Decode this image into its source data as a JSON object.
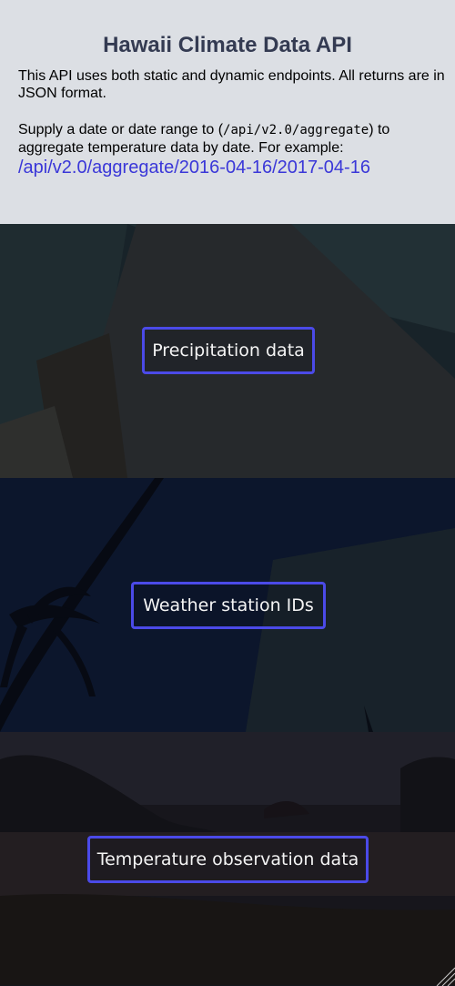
{
  "header": {
    "title": "Hawaii Climate Data API",
    "intro": "This API uses both static and dynamic endpoints. All returns are in JSON format.",
    "aggregate_prefix": "Supply a date or date range to (",
    "aggregate_code": "/api/v2.0/aggregate",
    "aggregate_suffix": ") to aggregate temperature data by date. For example:",
    "example_link": "/api/v2.0/aggregate/2016-04-16/2017-04-16"
  },
  "panels": [
    {
      "label": "Precipitation data"
    },
    {
      "label": "Weather station IDs"
    },
    {
      "label": "Temperature observation data"
    }
  ],
  "colors": {
    "header_bg": "#dcdfe4",
    "title": "#343b52",
    "link": "#3a37d8",
    "button_border": "#4b4ae8"
  }
}
